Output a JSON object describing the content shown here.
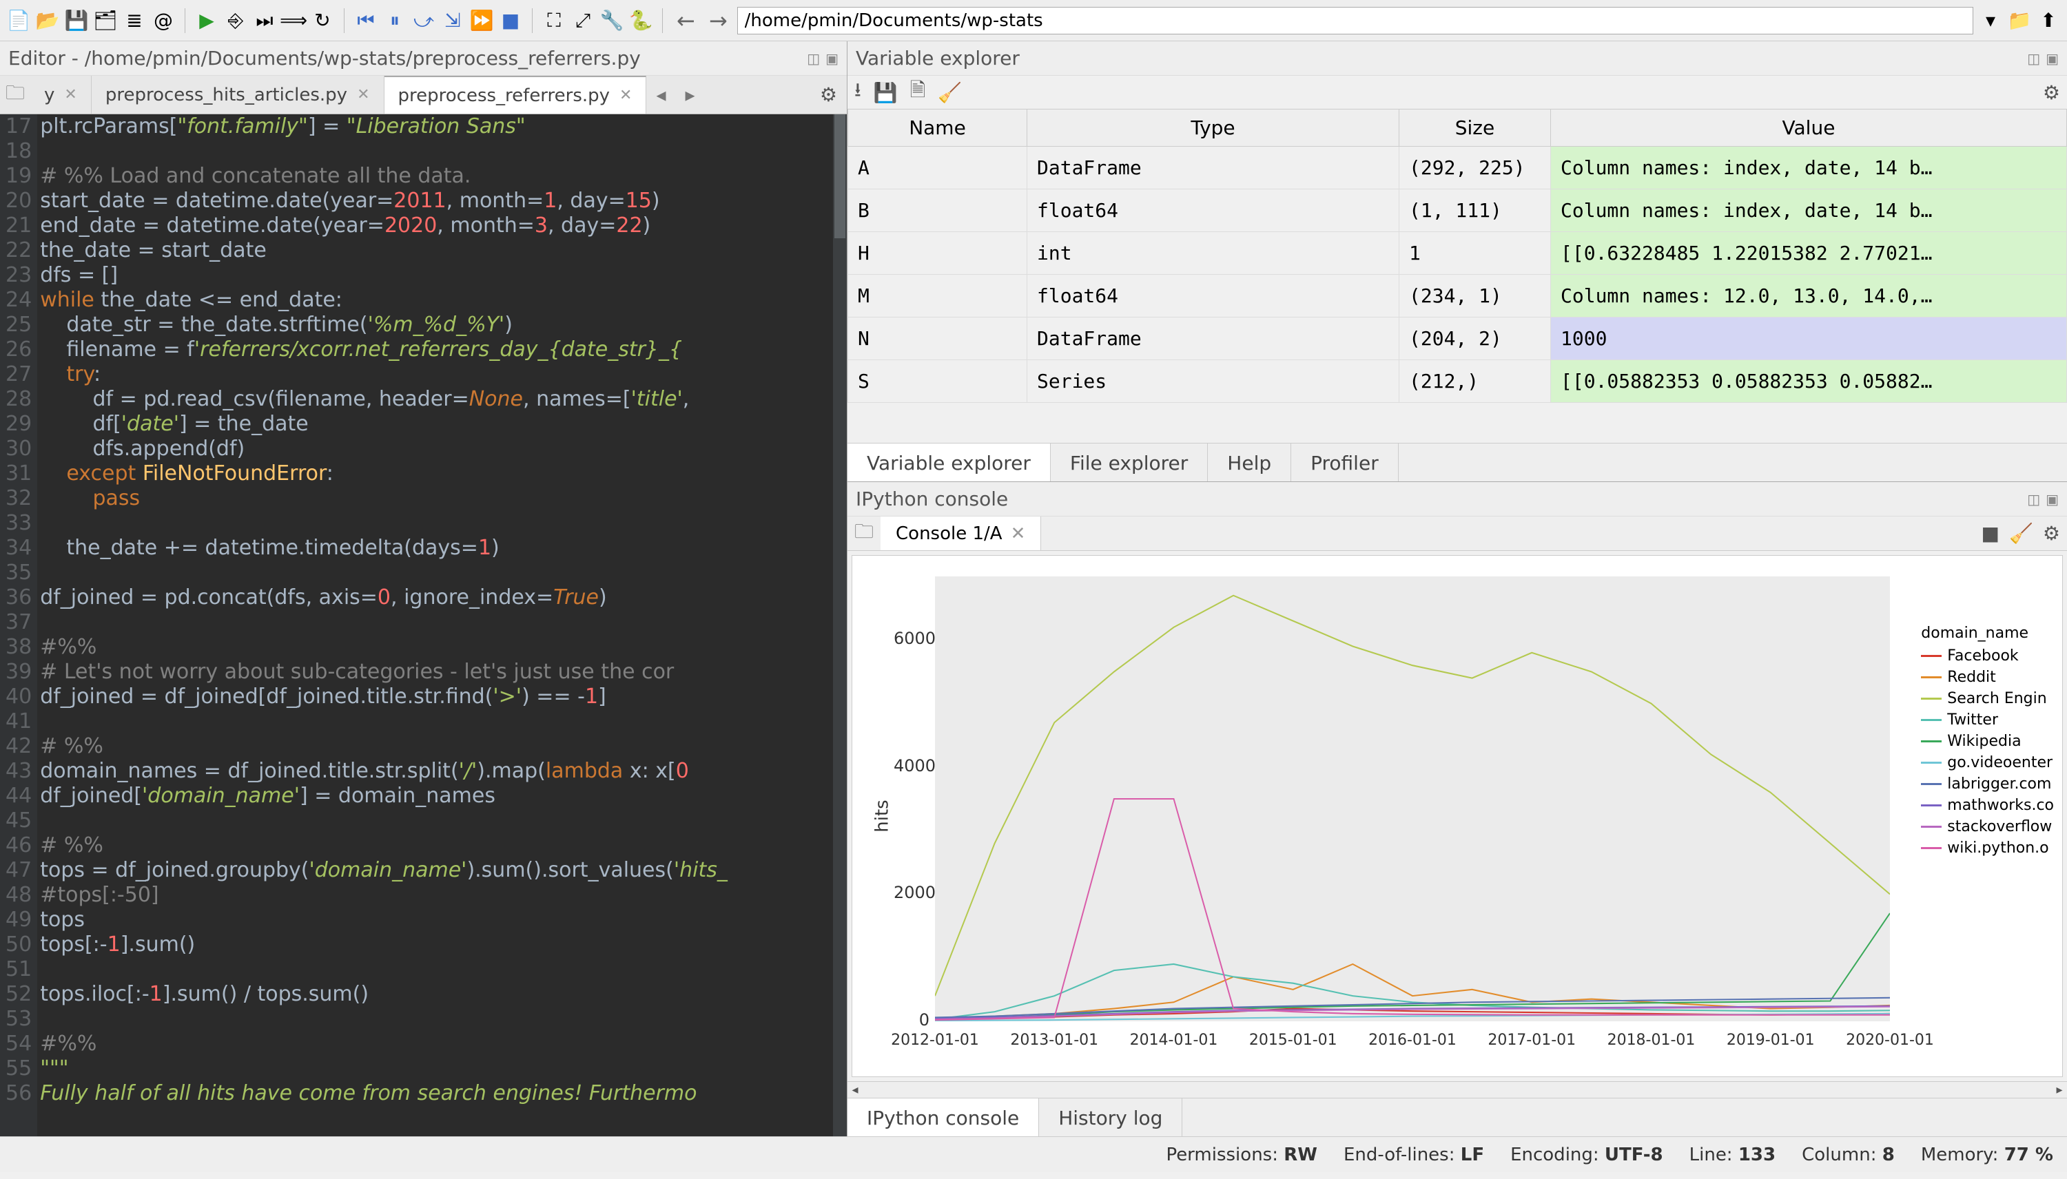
{
  "toolbar": {
    "cwd": "/home/pmin/Documents/wp-stats"
  },
  "editor": {
    "title": "Editor - /home/pmin/Documents/wp-stats/preprocess_referrers.py",
    "tabs": [
      {
        "label": "y",
        "active": false,
        "partial": true
      },
      {
        "label": "preprocess_hits_articles.py",
        "active": false
      },
      {
        "label": "preprocess_referrers.py",
        "active": true
      }
    ],
    "first_line_number": 17,
    "lines": [
      [
        [
          "plain",
          "plt.rcParams["
        ],
        [
          "str",
          "\"font.family\""
        ],
        [
          "plain",
          "] = "
        ],
        [
          "str",
          "\"Liberation Sans\""
        ]
      ],
      [],
      [
        [
          "cmt",
          "# %% Load and concatenate all the data."
        ]
      ],
      [
        [
          "plain",
          "start_date = datetime.date(year="
        ],
        [
          "num",
          "2011"
        ],
        [
          "plain",
          ", month="
        ],
        [
          "num",
          "1"
        ],
        [
          "plain",
          ", day="
        ],
        [
          "num",
          "15"
        ],
        [
          "plain",
          ")"
        ]
      ],
      [
        [
          "plain",
          "end_date = datetime.date(year="
        ],
        [
          "num",
          "2020"
        ],
        [
          "plain",
          ", month="
        ],
        [
          "num",
          "3"
        ],
        [
          "plain",
          ", day="
        ],
        [
          "num",
          "22"
        ],
        [
          "plain",
          ")"
        ]
      ],
      [
        [
          "plain",
          "the_date = start_date"
        ]
      ],
      [
        [
          "plain",
          "dfs = []"
        ]
      ],
      [
        [
          "kw",
          "while"
        ],
        [
          "plain",
          " the_date <= end_date:"
        ]
      ],
      [
        [
          "plain",
          "    date_str = the_date.strftime("
        ],
        [
          "str",
          "'%m_%d_%Y'"
        ],
        [
          "plain",
          ")"
        ]
      ],
      [
        [
          "plain",
          "    filename = f"
        ],
        [
          "str",
          "'referrers/xcorr.net_referrers_day_{date_str}_{"
        ]
      ],
      [
        [
          "plain",
          "    "
        ],
        [
          "kw",
          "try"
        ],
        [
          "plain",
          ":"
        ]
      ],
      [
        [
          "plain",
          "        df = pd.read_csv(filename, header="
        ],
        [
          "const",
          "None"
        ],
        [
          "plain",
          ", names=["
        ],
        [
          "str",
          "'title'"
        ],
        [
          "plain",
          ","
        ]
      ],
      [
        [
          "plain",
          "        df["
        ],
        [
          "str",
          "'date'"
        ],
        [
          "plain",
          "] = the_date"
        ]
      ],
      [
        [
          "plain",
          "        dfs.append(df)"
        ]
      ],
      [
        [
          "plain",
          "    "
        ],
        [
          "kw",
          "except"
        ],
        [
          "plain",
          " "
        ],
        [
          "fn",
          "FileNotFoundError"
        ],
        [
          "plain",
          ":"
        ]
      ],
      [
        [
          "plain",
          "        "
        ],
        [
          "kw",
          "pass"
        ]
      ],
      [],
      [
        [
          "plain",
          "    the_date += datetime.timedelta(days="
        ],
        [
          "num",
          "1"
        ],
        [
          "plain",
          ")"
        ]
      ],
      [],
      [
        [
          "plain",
          "df_joined = pd.concat(dfs, axis="
        ],
        [
          "num",
          "0"
        ],
        [
          "plain",
          ", ignore_index="
        ],
        [
          "const",
          "True"
        ],
        [
          "plain",
          ")"
        ]
      ],
      [],
      [
        [
          "cmt",
          "#%%"
        ]
      ],
      [
        [
          "cmt",
          "# Let's not worry about sub-categories - let's just use the cor"
        ]
      ],
      [
        [
          "plain",
          "df_joined = df_joined[df_joined.title.str.find("
        ],
        [
          "str",
          "'>'"
        ],
        [
          "plain",
          ") == -"
        ],
        [
          "num",
          "1"
        ],
        [
          "plain",
          "]"
        ]
      ],
      [],
      [
        [
          "cmt",
          "# %%"
        ]
      ],
      [
        [
          "plain",
          "domain_names = df_joined.title.str.split("
        ],
        [
          "str",
          "'/'"
        ],
        [
          "plain",
          ").map("
        ],
        [
          "kw",
          "lambda"
        ],
        [
          "plain",
          " x: x["
        ],
        [
          "num",
          "0"
        ]
      ],
      [
        [
          "plain",
          "df_joined["
        ],
        [
          "str",
          "'domain_name'"
        ],
        [
          "plain",
          "] = domain_names"
        ]
      ],
      [],
      [
        [
          "cmt",
          "# %%"
        ]
      ],
      [
        [
          "plain",
          "tops = df_joined.groupby("
        ],
        [
          "str",
          "'domain_name'"
        ],
        [
          "plain",
          ").sum().sort_values("
        ],
        [
          "str",
          "'hits_"
        ]
      ],
      [
        [
          "cmt",
          "#tops[:-50]"
        ]
      ],
      [
        [
          "plain",
          "tops"
        ]
      ],
      [
        [
          "plain",
          "tops[:-"
        ],
        [
          "num",
          "1"
        ],
        [
          "plain",
          "].sum()"
        ]
      ],
      [],
      [
        [
          "plain",
          "tops.iloc[:-"
        ],
        [
          "num",
          "1"
        ],
        [
          "plain",
          "].sum() / tops.sum()"
        ]
      ],
      [],
      [
        [
          "cmt",
          "#%%"
        ]
      ],
      [
        [
          "str",
          "\"\"\""
        ]
      ],
      [
        [
          "str",
          "Fully half of all hits have come from search engines! Furthermo"
        ]
      ]
    ]
  },
  "varexp": {
    "title": "Variable explorer",
    "headers": [
      "Name",
      "Type",
      "Size",
      "Value"
    ],
    "rows": [
      {
        "name": "A",
        "type": "DataFrame",
        "size": "(292, 225)",
        "value": "Column names: index, date, 14 b…",
        "cls": "g"
      },
      {
        "name": "B",
        "type": "float64",
        "size": "(1, 111)",
        "value": "Column names: index, date, 14 b…",
        "cls": "g"
      },
      {
        "name": "H",
        "type": "int",
        "size": "1",
        "value": "[[0.63228485 1.22015382 2.77021…",
        "cls": "g"
      },
      {
        "name": "M",
        "type": "float64",
        "size": "(234, 1)",
        "value": "Column names: 12.0, 13.0, 14.0,…",
        "cls": "g"
      },
      {
        "name": "N",
        "type": "DataFrame",
        "size": "(204, 2)",
        "value": "1000",
        "cls": "b"
      },
      {
        "name": "S",
        "type": "Series",
        "size": "(212,)",
        "value": "[[0.05882353 0.05882353 0.05882…",
        "cls": "g"
      }
    ],
    "tabs": [
      {
        "label": "Variable explorer",
        "active": true
      },
      {
        "label": "File explorer",
        "active": false
      },
      {
        "label": "Help",
        "active": false
      },
      {
        "label": "Profiler",
        "active": false
      }
    ]
  },
  "console": {
    "title": "IPython console",
    "tab_label": "Console 1/A",
    "bottom_tabs": [
      {
        "label": "IPython console",
        "active": true
      },
      {
        "label": "History log",
        "active": false
      }
    ],
    "plot": {
      "ylabel": "hits",
      "yticks": [
        0,
        2000,
        4000,
        6000
      ],
      "xticks": [
        "2012-01-01",
        "2013-01-01",
        "2014-01-01",
        "2015-01-01",
        "2016-01-01",
        "2017-01-01",
        "2018-01-01",
        "2019-01-01",
        "2020-01-01"
      ],
      "legend_title": "domain_name",
      "legend": [
        {
          "label": "Facebook",
          "color": "#d73a2c"
        },
        {
          "label": "Reddit",
          "color": "#e28c2b"
        },
        {
          "label": "Search Engin",
          "color": "#b4c94f"
        },
        {
          "label": "Twitter",
          "color": "#55c0b2"
        },
        {
          "label": "Wikipedia",
          "color": "#3aa95a"
        },
        {
          "label": "go.videoenter",
          "color": "#6fc6d6"
        },
        {
          "label": "labrigger.com",
          "color": "#5873b2"
        },
        {
          "label": "mathworks.co",
          "color": "#7a62c4"
        },
        {
          "label": "stackoverflow",
          "color": "#b768c0"
        },
        {
          "label": "wiki.python.o",
          "color": "#d95ca9"
        }
      ]
    }
  },
  "status": {
    "permissions_label": "Permissions:",
    "permissions_value": "RW",
    "eol_label": "End-of-lines:",
    "eol_value": "LF",
    "encoding_label": "Encoding:",
    "encoding_value": "UTF-8",
    "line_label": "Line:",
    "line_value": "133",
    "col_label": "Column:",
    "col_value": "8",
    "mem_label": "Memory:",
    "mem_value": "77 %"
  },
  "chart_data": {
    "type": "line",
    "title": "",
    "xlabel": "",
    "ylabel": "hits",
    "ylim": [
      0,
      7000
    ],
    "x": [
      "2012-01-01",
      "2012-07-01",
      "2013-01-01",
      "2013-07-01",
      "2014-01-01",
      "2014-07-01",
      "2015-01-01",
      "2015-07-01",
      "2016-01-01",
      "2016-07-01",
      "2017-01-01",
      "2017-07-01",
      "2018-01-01",
      "2018-07-01",
      "2019-01-01",
      "2019-07-01",
      "2020-01-01"
    ],
    "series": [
      {
        "name": "Facebook",
        "color": "#d73a2c",
        "values": [
          50,
          60,
          70,
          100,
          120,
          150,
          200,
          180,
          160,
          150,
          140,
          130,
          120,
          110,
          100,
          110,
          120
        ]
      },
      {
        "name": "Reddit",
        "color": "#e28c2b",
        "values": [
          40,
          80,
          120,
          200,
          300,
          700,
          500,
          900,
          400,
          500,
          300,
          350,
          300,
          250,
          200,
          220,
          250
        ]
      },
      {
        "name": "Search Engin",
        "color": "#b4c94f",
        "values": [
          400,
          2800,
          4700,
          5500,
          6200,
          6700,
          6300,
          5900,
          5600,
          5400,
          5800,
          5500,
          5000,
          4200,
          3600,
          2800,
          2000
        ]
      },
      {
        "name": "Twitter",
        "color": "#55c0b2",
        "values": [
          30,
          150,
          400,
          800,
          900,
          700,
          600,
          400,
          300,
          250,
          220,
          200,
          180,
          170,
          160,
          160,
          170
        ]
      },
      {
        "name": "Wikipedia",
        "color": "#3aa95a",
        "values": [
          20,
          50,
          100,
          150,
          180,
          200,
          220,
          240,
          250,
          260,
          270,
          280,
          290,
          300,
          310,
          320,
          1700
        ]
      },
      {
        "name": "go.videoenter",
        "color": "#6fc6d6",
        "values": [
          10,
          15,
          20,
          30,
          40,
          50,
          60,
          70,
          80,
          85,
          90,
          95,
          100,
          105,
          110,
          115,
          120
        ]
      },
      {
        "name": "labrigger.com",
        "color": "#5873b2",
        "values": [
          60,
          80,
          120,
          160,
          200,
          220,
          240,
          260,
          280,
          300,
          310,
          320,
          330,
          340,
          350,
          360,
          370
        ]
      },
      {
        "name": "mathworks.co",
        "color": "#7a62c4",
        "values": [
          40,
          60,
          90,
          120,
          150,
          170,
          180,
          190,
          200,
          205,
          210,
          215,
          220,
          225,
          230,
          235,
          240
        ]
      },
      {
        "name": "stackoverflow",
        "color": "#b768c0",
        "values": [
          30,
          50,
          80,
          110,
          140,
          160,
          170,
          180,
          190,
          195,
          200,
          205,
          210,
          215,
          220,
          225,
          230
        ]
      },
      {
        "name": "wiki.python.o",
        "color": "#d95ca9",
        "values": [
          20,
          40,
          60,
          3500,
          3500,
          200,
          150,
          120,
          110,
          105,
          100,
          100,
          100,
          100,
          100,
          100,
          100
        ]
      }
    ]
  }
}
